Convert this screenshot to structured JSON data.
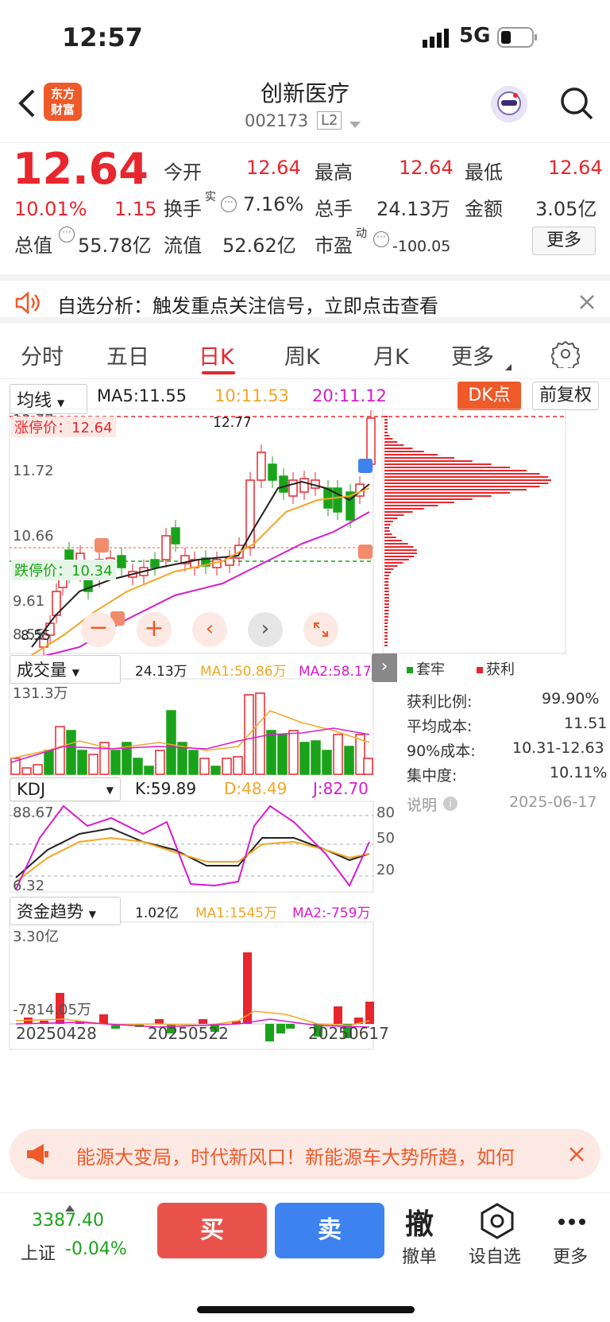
{
  "status": {
    "time": "12:57",
    "network": "5G"
  },
  "header": {
    "logo": "东方\n财富",
    "title": "创新医疗",
    "code": "002173",
    "level": "L2"
  },
  "quote": {
    "price": "12.64",
    "pct": "10.01%",
    "chg": "1.15",
    "fields": [
      {
        "k": "今开",
        "v": "12.64"
      },
      {
        "k": "最高",
        "v": "12.64"
      },
      {
        "k": "最低",
        "v": "12.64"
      },
      {
        "k": "换手",
        "sup": "实",
        "v": "7.16%"
      },
      {
        "k": "总手",
        "v": "24.13万"
      },
      {
        "k": "金额",
        "v": "3.05亿"
      },
      {
        "k": "总值",
        "v": "55.78亿"
      },
      {
        "k": "流值",
        "v": "52.62亿"
      },
      {
        "k": "市盈",
        "sup": "动",
        "v": "-100.05"
      }
    ],
    "more": "更多"
  },
  "notice": {
    "text": "自选分析：触发重点关注信号，立即点击查看"
  },
  "tabs": [
    "分时",
    "五日",
    "日K",
    "周K",
    "月K",
    "更多"
  ],
  "main": {
    "indicator": "均线",
    "ma5": "MA5:11.55",
    "ma10": "10:11.53",
    "ma20": "20:11.12",
    "dk": "DK点",
    "fq": "前复权",
    "yticks": [
      "12.77",
      "11.72",
      "10.66",
      "9.61",
      "8.55"
    ],
    "limit_up": "涨停价：12.64",
    "limit_down": "跌停价：10.34",
    "hi_label": "12.77",
    "lo_label": "8.55"
  },
  "volume": {
    "indicator": "成交量",
    "val": "24.13万",
    "ma1": "MA1:50.86万",
    "ma2": "MA2:58.17万",
    "top": "131.3万"
  },
  "kdj": {
    "indicator": "KDJ",
    "k": "K:59.89",
    "d": "D:48.49",
    "j": "J:82.70",
    "top": "88.67",
    "bottom": "6.32",
    "l80": "80",
    "l50": "50",
    "l20": "20"
  },
  "fund": {
    "indicator": "资金趋势",
    "val": "1.02亿",
    "ma1": "MA1:1545万",
    "ma2": "MA2:-759万",
    "top": "3.30亿",
    "bottom": "-7814.05万"
  },
  "dates": [
    "20250428",
    "20250522",
    "20250617"
  ],
  "chips": {
    "legend_trapped": "套牢",
    "legend_profit": "获利",
    "rows": [
      {
        "k": "获利比例:",
        "v": "99.90%"
      },
      {
        "k": "平均成本:",
        "v": "11.51"
      },
      {
        "k": "90%成本:",
        "v": "10.31-12.63"
      },
      {
        "k": "集中度:",
        "v": "10.11%"
      }
    ],
    "note": "说明",
    "date": "2025-06-17"
  },
  "ad": {
    "text": "能源大变局，时代新风口！新能源车大势所趋，如何"
  },
  "bottom": {
    "index_val": "3387.40",
    "index_name": "上证",
    "index_chg": "-0.04%",
    "buy": "买",
    "sell": "卖",
    "cancel_icon": "撤",
    "cancel": "撤单",
    "watch": "设自选",
    "more": "更多"
  },
  "colors": {
    "up": "#e8262d",
    "down": "#1aa31a",
    "ma10": "#f5a623",
    "ma20": "#d81bd0"
  }
}
